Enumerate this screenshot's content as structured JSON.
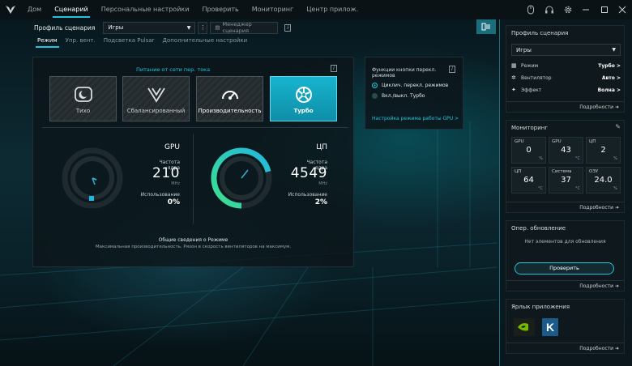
{
  "nav": {
    "tabs": [
      {
        "label": "Дом"
      },
      {
        "label": "Сценарий"
      },
      {
        "label": "Персональные настройки"
      },
      {
        "label": "Проверить"
      },
      {
        "label": "Мониторинг"
      },
      {
        "label": "Центр прилож."
      }
    ]
  },
  "profile_bar": {
    "label": "Профиль сценария",
    "selected": "Игры",
    "manager_label": "Менеджер сценария"
  },
  "subtabs": [
    {
      "label": "Режим"
    },
    {
      "label": "Упр. вент."
    },
    {
      "label": "Подсветка Pulsar"
    },
    {
      "label": "Дополнительные настройки"
    }
  ],
  "mode_panel": {
    "power_title": "Питание от сети пер. тока",
    "modes": [
      {
        "label": "Тихо",
        "icon": "quiet-icon"
      },
      {
        "label": "Сбалансированный",
        "icon": "balanced-icon"
      },
      {
        "label": "Производительность",
        "icon": "performance-icon"
      },
      {
        "label": "Турбо",
        "icon": "turbo-icon"
      }
    ],
    "active_mode": "Турбо",
    "gpu": {
      "title": "GPU",
      "freq_label": "Частота ядра",
      "freq_value": "210",
      "freq_unit": "MHz",
      "usage_label": "Использование",
      "usage_value": "0%",
      "usage_fraction": 0.0
    },
    "cpu": {
      "title": "ЦП",
      "freq_label": "Частота ядра",
      "freq_value": "4549",
      "freq_unit": "MHz",
      "usage_label": "Использование",
      "usage_value": "2%",
      "usage_fraction": 0.02
    },
    "summary_title": "Общие сведения о Режиме",
    "summary_text": "Максимальная производительность. Рязон в скорость вентиляторов на максимум."
  },
  "function_panel": {
    "title": "Функции кнопки перекл. режимов",
    "options": [
      {
        "label": "Циклич. перекл. режимов",
        "selected": true
      },
      {
        "label": "Вкл./выкл. Турбо",
        "selected": false
      }
    ],
    "gpu_link": "Настройка режима работы GPU >"
  },
  "right": {
    "profile_card": {
      "title": "Профиль сценария",
      "selected": "Игры",
      "rows": [
        {
          "key": "Режим",
          "value": "Турбо >",
          "icon": "mode-icon"
        },
        {
          "key": "Вентилятор",
          "value": "Авто >",
          "icon": "fan-icon"
        },
        {
          "key": "Эффект",
          "value": "Волна >",
          "icon": "effect-icon"
        }
      ],
      "more": "Подробности"
    },
    "monitor_card": {
      "title": "Мониторинг",
      "tiles": [
        {
          "label": "GPU",
          "value": "0",
          "unit": "%"
        },
        {
          "label": "GPU",
          "value": "43",
          "unit": "°C"
        },
        {
          "label": "ЦП",
          "value": "2",
          "unit": "%"
        },
        {
          "label": "ЦП",
          "value": "64",
          "unit": "°C"
        },
        {
          "label": "Система",
          "value": "37",
          "unit": "°C"
        },
        {
          "label": "ОЗУ",
          "value": "24.0",
          "unit": "%"
        }
      ],
      "more": "Подробности"
    },
    "update_card": {
      "title": "Опер. обновление",
      "empty_text": "Нет элементов для обновления",
      "check_button": "Проверить",
      "more": "Подробности"
    },
    "shortcut_card": {
      "title": "Ярлык приложения",
      "apps": [
        {
          "icon": "nvidia-icon"
        },
        {
          "icon": "k-app-icon"
        }
      ],
      "more": "Подробности"
    }
  },
  "colors": {
    "accent": "#21c4dc",
    "gauge_gradient_start": "#3ee08c",
    "gauge_gradient_end": "#21b8e0"
  }
}
